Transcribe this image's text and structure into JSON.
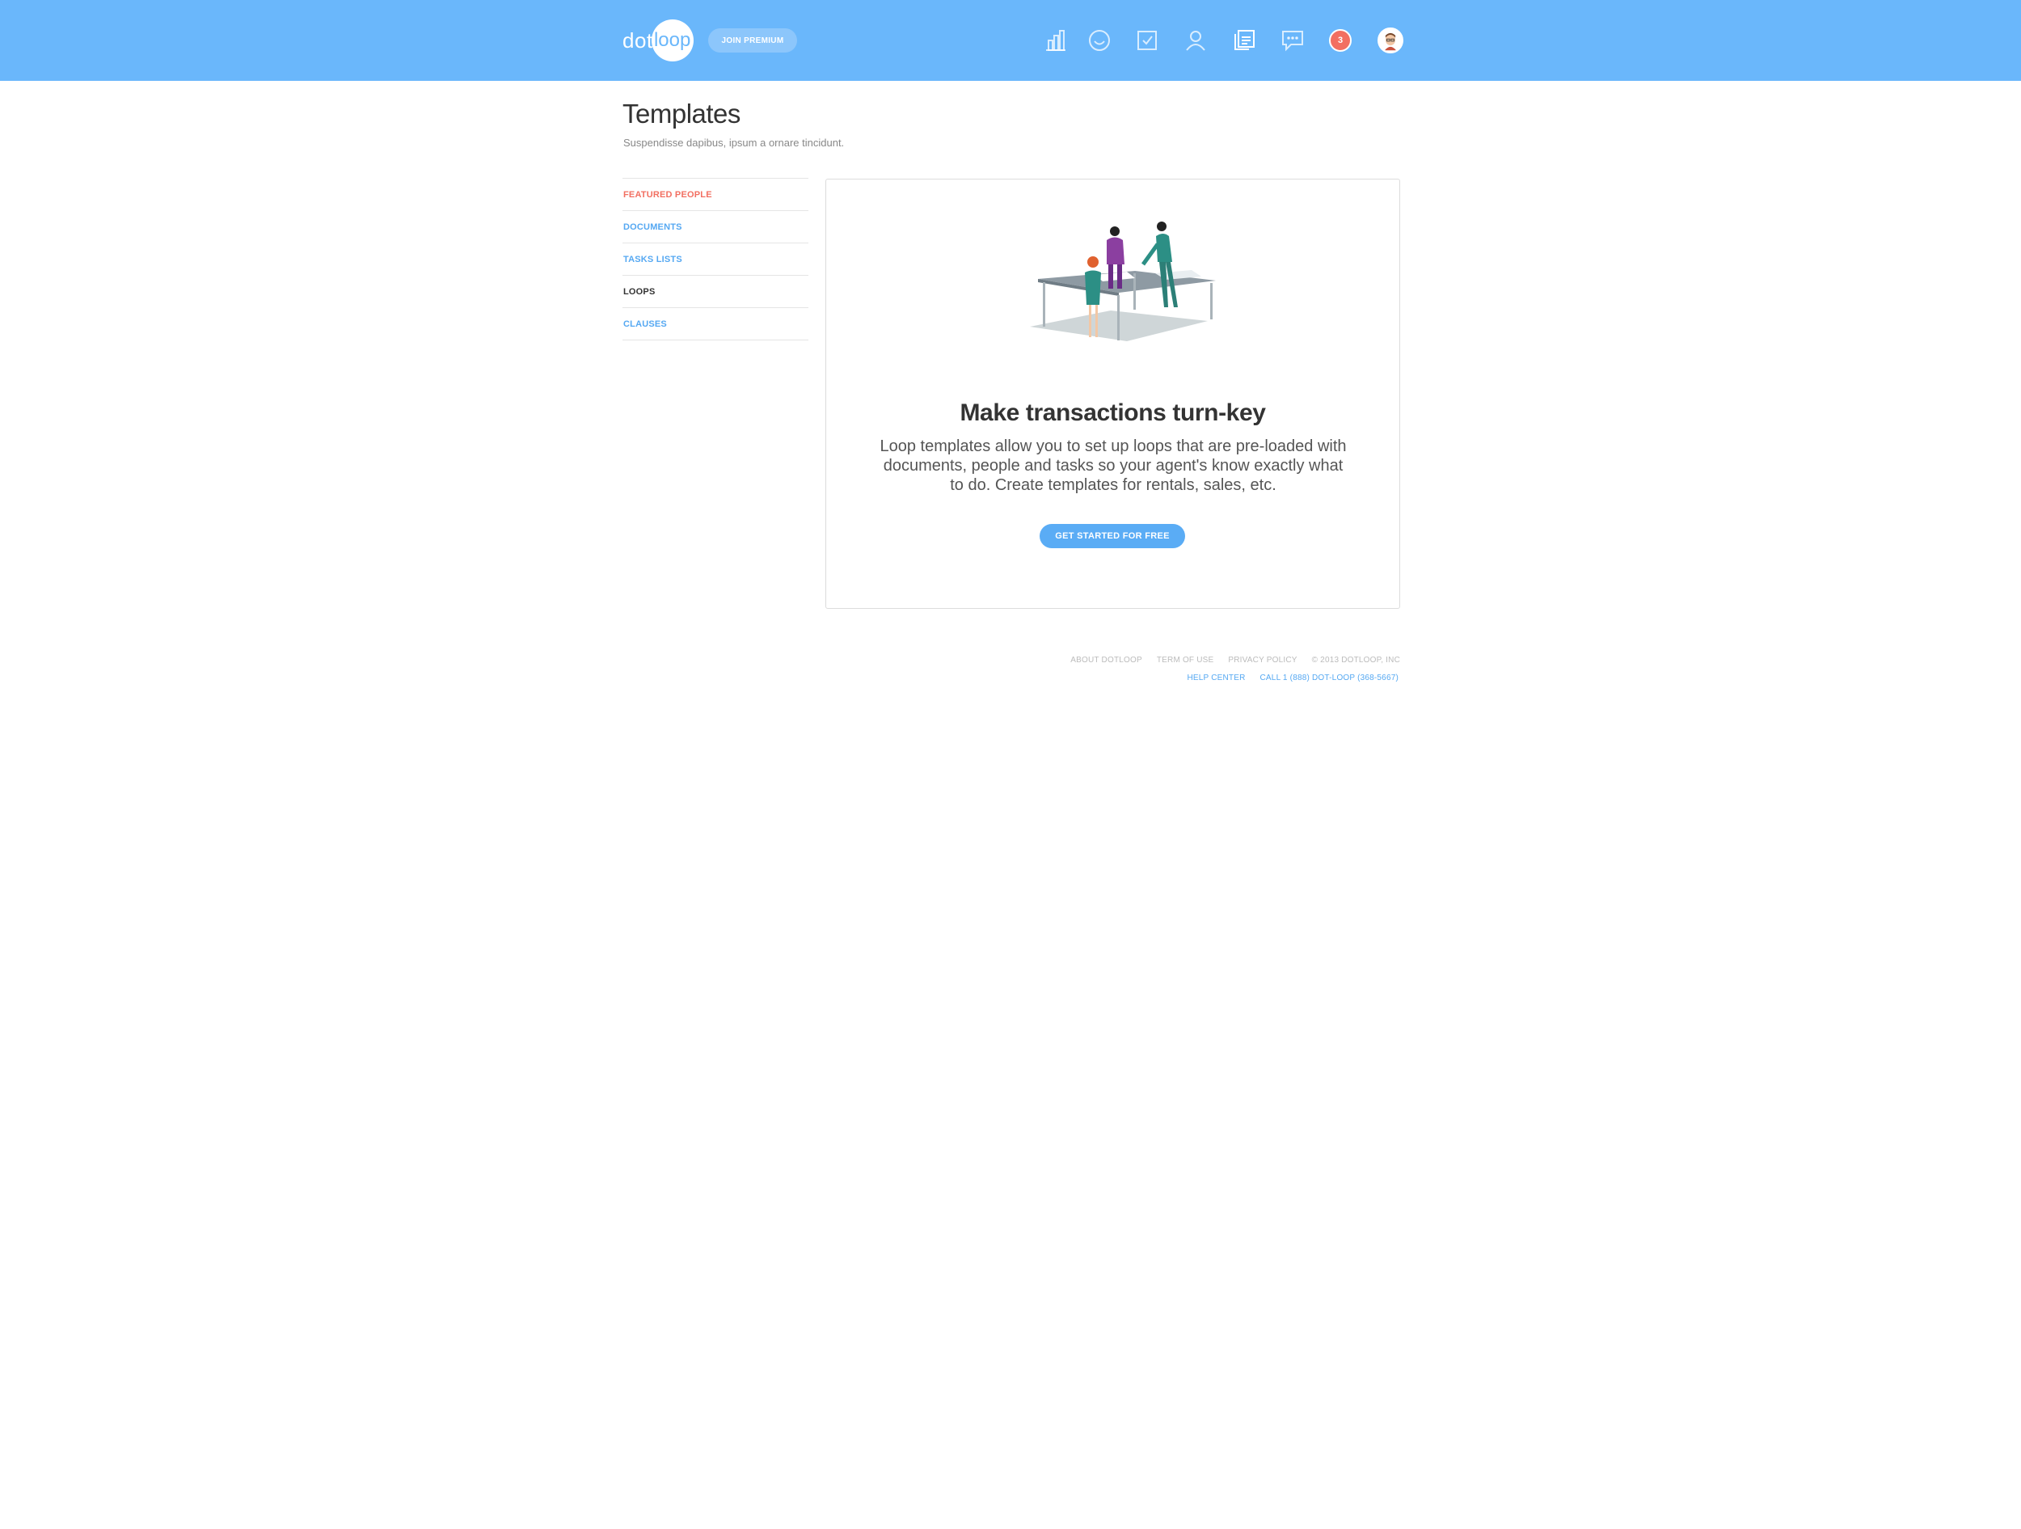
{
  "header": {
    "logo_left": "dot",
    "logo_right": "loop",
    "join_premium_label": "JOIN PREMIUM",
    "nav_icons": [
      "bar-chart-icon",
      "smile-icon",
      "checklist-icon",
      "person-icon",
      "documents-icon",
      "chat-icon"
    ],
    "notifications_count": "3",
    "colors": {
      "bar": "#6ab7fb",
      "badge": "#f26f61"
    }
  },
  "page": {
    "title": "Templates",
    "subtitle": "Suspendisse dapibus, ipsum a ornare tincidunt."
  },
  "sidebar": {
    "items": [
      {
        "label": "FEATURED PEOPLE",
        "color": "#f26f61"
      },
      {
        "label": "DOCUMENTS",
        "color": "#55a8f2"
      },
      {
        "label": "TASKS LISTS",
        "color": "#55a8f2"
      },
      {
        "label": "LOOPS",
        "color": "#333333",
        "selected": true
      },
      {
        "label": "CLAUSES",
        "color": "#55a8f2"
      }
    ]
  },
  "card": {
    "title": "Make transactions turn-key",
    "body": "Loop templates allow you to set up loops that are pre-loaded with documents, people and tasks so your agent's know exactly what to do. Create templates for rentals, sales, etc.",
    "cta_label": "GET STARTED FOR FREE",
    "illustration": "people-at-table-illustration"
  },
  "footer": {
    "about": "ABOUT DOTLOOP",
    "terms": "TERM OF USE",
    "privacy": "PRIVACY POLICY",
    "copyright": "© 2013 DOTLOOP, INC",
    "help": "HELP CENTER",
    "call": "CALL 1 (888) DOT-LOOP (368-5667)"
  }
}
